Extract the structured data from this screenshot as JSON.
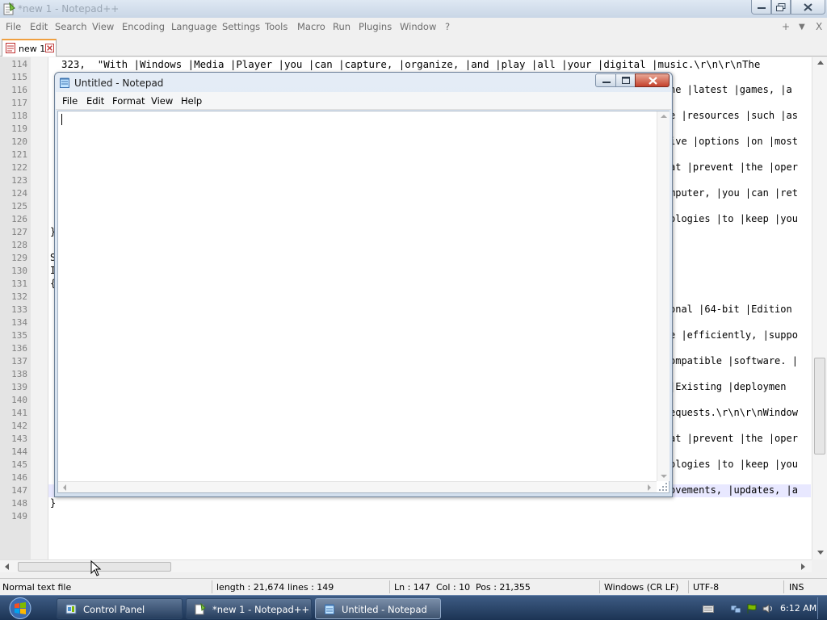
{
  "npp": {
    "title": "*new 1 - Notepad++",
    "menu": [
      "File",
      "Edit",
      "Search",
      "View",
      "Encoding",
      "Language",
      "Settings",
      "Tools",
      "Macro",
      "Run",
      "Plugins",
      "Window",
      "?"
    ],
    "menu_right": {
      "plus": "+",
      "down": "▼",
      "close": "X"
    },
    "tab_label": "new 1",
    "line_numbers": [
      "114",
      "115",
      "116",
      "117",
      "118",
      "119",
      "120",
      "121",
      "122",
      "123",
      "124",
      "125",
      "126",
      "127",
      "128",
      "129",
      "130",
      "131",
      "132",
      "133",
      "134",
      "135",
      "136",
      "137",
      "138",
      "139",
      "140",
      "141",
      "142",
      "143",
      "144",
      "145",
      "146",
      "147",
      "148",
      "149"
    ],
    "line_114": "323,  \"With |Windows |Media |Player |you |can |capture, |organize, |and |play |all |your |digital |music.\\r\\n\\r\\nThe",
    "right_fragments": {
      "l116": "he |latest |games, |a",
      "l118": "e |resources |such |as",
      "l120": "ive |options |on |most",
      "l122": "at |prevent |the |oper",
      "l124": "mputer, |you |can |ret",
      "l126": "ologies |to |keep |you",
      "l133": "onal |64-bit |Edition",
      "l135": "e |efficiently, |suppo",
      "l137": "ompatible |software. |",
      "l139": " |Existing |deploymen",
      "l141": "equests.\\r\\n\\r\\nWindow",
      "l143": "at |prevent |the |oper",
      "l145": "ologies |to |keep |you",
      "l147": "ovements, |updates, |a"
    },
    "left_fragments": {
      "l127": "}",
      "l129": "S",
      "l130": "I",
      "l131": "{",
      "l148": "}"
    },
    "status": {
      "type": "Normal text file",
      "length": "length : 21,674",
      "lines": "lines : 149",
      "ln": "Ln : 147",
      "col": "Col : 10",
      "pos": "Pos : 21,355",
      "eol": "Windows (CR LF)",
      "encoding": "UTF-8",
      "mode": "INS"
    }
  },
  "notepad": {
    "title": "Untitled - Notepad",
    "menu": [
      "File",
      "Edit",
      "Format",
      "View",
      "Help"
    ]
  },
  "taskbar": {
    "buttons": [
      "Control Panel",
      "*new 1 - Notepad++",
      "Untitled - Notepad"
    ],
    "clock": "6:12 AM"
  }
}
